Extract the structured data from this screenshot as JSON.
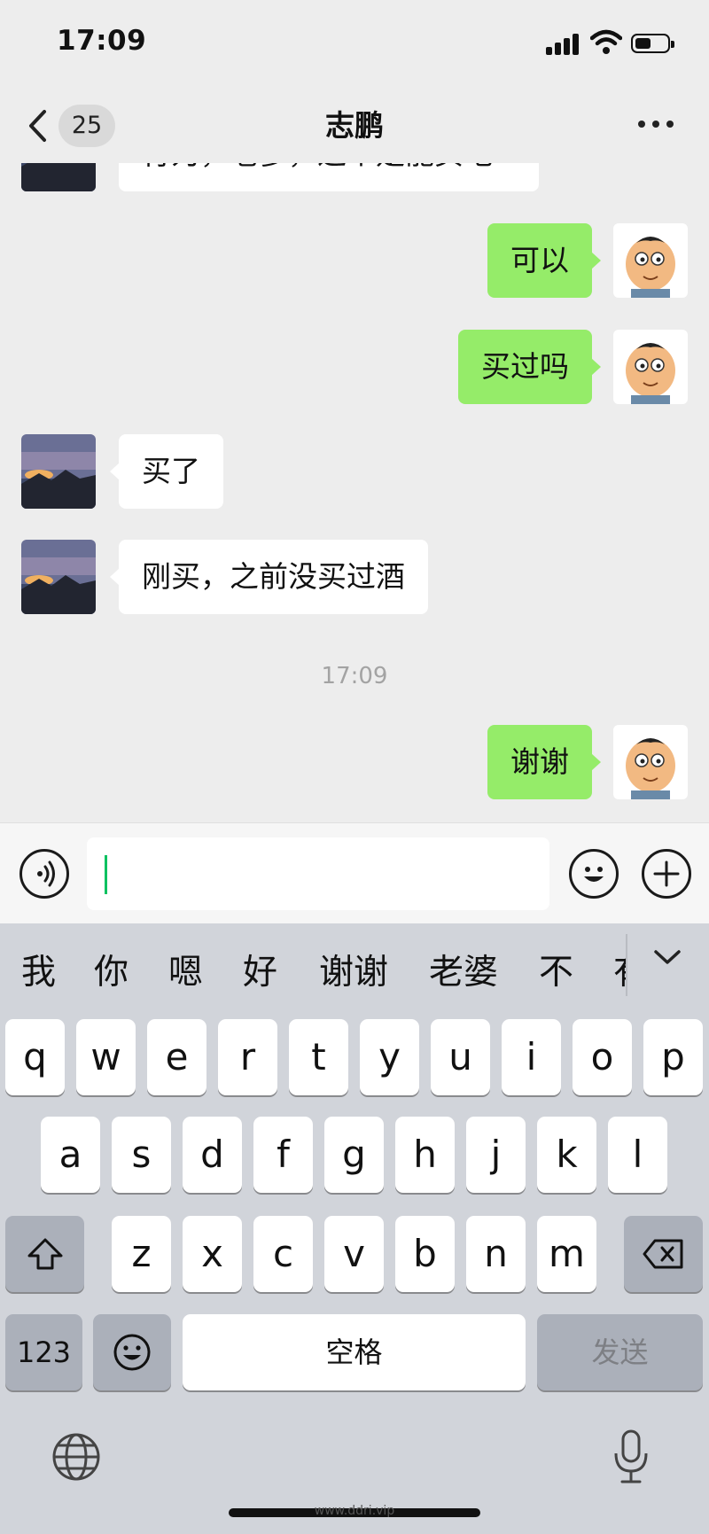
{
  "status_bar": {
    "time": "17:09"
  },
  "nav": {
    "back_count": "25",
    "title": "志鹏"
  },
  "chat": {
    "cut_message": "行为，老爹，这个是能买吧",
    "messages": [
      {
        "side": "out",
        "text": "可以"
      },
      {
        "side": "out",
        "text": "买过吗"
      },
      {
        "side": "in",
        "text": "买了"
      },
      {
        "side": "in",
        "text": "刚买，之前没买过酒"
      },
      {
        "side": "out",
        "text": "谢谢"
      }
    ],
    "timestamp": "17:09"
  },
  "input_bar": {
    "value": ""
  },
  "keyboard": {
    "candidates": [
      "我",
      "你",
      "嗯",
      "好",
      "谢谢",
      "老婆",
      "不",
      "有"
    ],
    "row1": [
      "q",
      "w",
      "e",
      "r",
      "t",
      "y",
      "u",
      "i",
      "o",
      "p"
    ],
    "row2": [
      "a",
      "s",
      "d",
      "f",
      "g",
      "h",
      "j",
      "k",
      "l"
    ],
    "row3": [
      "z",
      "x",
      "c",
      "v",
      "b",
      "n",
      "m"
    ],
    "numbers_label": "123",
    "space_label": "空格",
    "send_label": "发送"
  },
  "watermark": "www.ddri.vip",
  "colors": {
    "bubble_out": "#95ec69",
    "bubble_in": "#ffffff",
    "background": "#ededed",
    "caret": "#07c160"
  }
}
